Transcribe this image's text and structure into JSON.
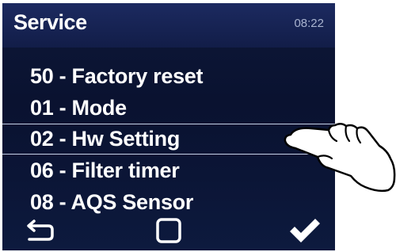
{
  "header": {
    "title": "Service",
    "time": "08:22"
  },
  "menu": {
    "items": [
      {
        "label": "50 - Factory reset"
      },
      {
        "label": "01 - Mode"
      },
      {
        "label": "02 - Hw Setting",
        "selected": true
      },
      {
        "label": "06 - Filter timer"
      },
      {
        "label": "08 - AQS Sensor"
      }
    ]
  },
  "nav": {
    "back_icon": "back-arrow-icon",
    "home_icon": "square-icon",
    "confirm_icon": "checkmark-icon"
  },
  "colors": {
    "background": "#0a1230",
    "header": "#1c2a60",
    "text": "#ffffff",
    "clock": "#a9b3cf",
    "divider": "#c8d0e6"
  },
  "overlay": {
    "icon": "pointing-hand-icon"
  }
}
